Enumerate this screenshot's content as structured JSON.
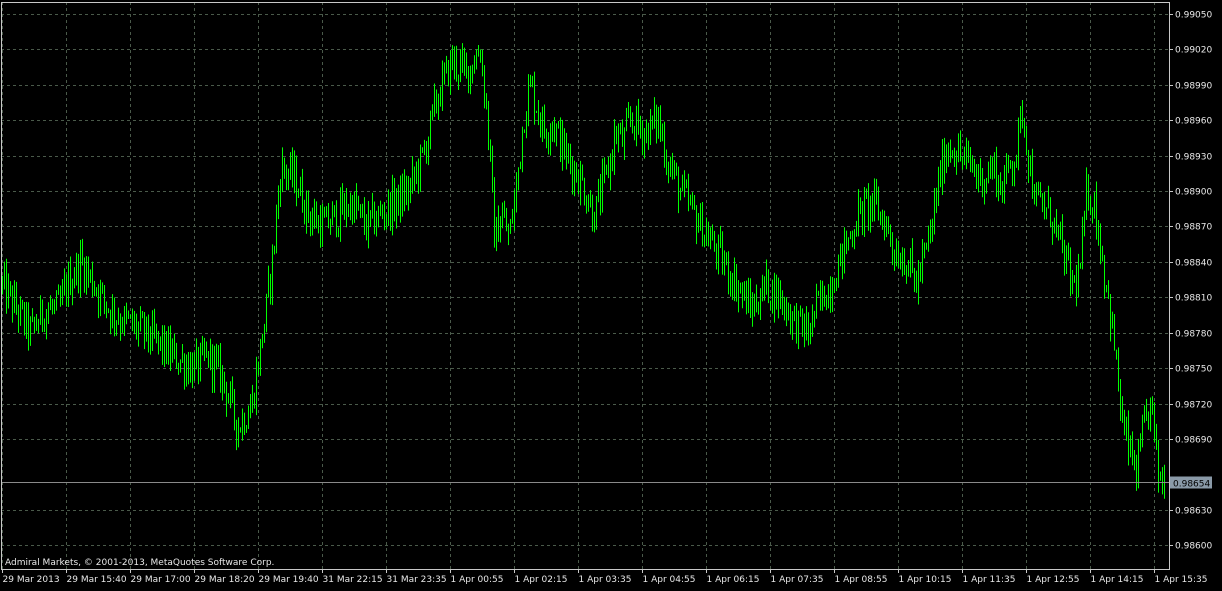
{
  "copyright": "Admiral Markets, © 2001-2013, MetaQuotes Software Corp.",
  "colors": {
    "background": "#000000",
    "grid": "#4a5a4a",
    "frame": "#c8c8c8",
    "bullish": "#00ff00",
    "bearish": "#00ff00",
    "bid_line": "#8a8a8a",
    "bid_label_bg": "#8a9aa8",
    "text": "#e8e8e8"
  },
  "chart_data": {
    "type": "candlestick",
    "grid": true,
    "ylim": [
      0.9858,
      0.9906
    ],
    "y_ticks": [
      "0.99050",
      "0.99020",
      "0.98990",
      "0.98960",
      "0.98930",
      "0.98900",
      "0.98870",
      "0.98840",
      "0.98810",
      "0.98780",
      "0.98750",
      "0.98720",
      "0.98690",
      "0.98630",
      "0.98600"
    ],
    "x_ticks": [
      "29 Mar 2013",
      "29 Mar 15:40",
      "29 Mar 17:00",
      "29 Mar 18:20",
      "29 Mar 19:40",
      "31 Mar 22:15",
      "31 Mar 23:35",
      "1 Apr 00:55",
      "1 Apr 02:15",
      "1 Apr 03:35",
      "1 Apr 04:55",
      "1 Apr 06:15",
      "1 Apr 07:35",
      "1 Apr 08:55",
      "1 Apr 10:15",
      "1 Apr 11:35",
      "1 Apr 12:55",
      "1 Apr 14:15",
      "1 Apr 15:35"
    ],
    "current_bid": "0.98654",
    "close_path": [
      [
        0,
        0.9882
      ],
      [
        2,
        0.988
      ],
      [
        4,
        0.9878
      ],
      [
        6,
        0.988
      ],
      [
        8,
        0.988
      ],
      [
        9,
        0.9882
      ],
      [
        11,
        0.9884
      ],
      [
        13,
        0.9882
      ],
      [
        15,
        0.988
      ],
      [
        17,
        0.9879
      ],
      [
        20,
        0.9878
      ],
      [
        24,
        0.9876
      ],
      [
        27,
        0.9875
      ],
      [
        29,
        0.9876
      ],
      [
        31,
        0.9874
      ],
      [
        33,
        0.987
      ],
      [
        35,
        0.9872
      ],
      [
        36,
        0.9876
      ],
      [
        37,
        0.988
      ],
      [
        38,
        0.9885
      ],
      [
        39,
        0.9892
      ],
      [
        41,
        0.9891
      ],
      [
        43,
        0.9888
      ],
      [
        45,
        0.9887
      ],
      [
        47,
        0.9888
      ],
      [
        49,
        0.9889
      ],
      [
        51,
        0.9887
      ],
      [
        53,
        0.9888
      ],
      [
        55,
        0.9889
      ],
      [
        57,
        0.989
      ],
      [
        59,
        0.9893
      ],
      [
        61,
        0.9898
      ],
      [
        63,
        0.9901
      ],
      [
        65,
        0.99
      ],
      [
        66,
        0.9901
      ],
      [
        67,
        0.9902
      ],
      [
        68,
        0.9896
      ],
      [
        69,
        0.9886
      ],
      [
        70,
        0.9888
      ],
      [
        71,
        0.9886
      ],
      [
        72,
        0.989
      ],
      [
        73,
        0.9896
      ],
      [
        74,
        0.9899
      ],
      [
        75,
        0.9897
      ],
      [
        76,
        0.9895
      ],
      [
        77,
        0.9896
      ],
      [
        79,
        0.9893
      ],
      [
        81,
        0.9891
      ],
      [
        83,
        0.9888
      ],
      [
        85,
        0.9892
      ],
      [
        86,
        0.9895
      ],
      [
        87,
        0.9894
      ],
      [
        88,
        0.9896
      ],
      [
        90,
        0.9895
      ],
      [
        92,
        0.9896
      ],
      [
        93,
        0.9893
      ],
      [
        95,
        0.989
      ],
      [
        97,
        0.9888
      ],
      [
        99,
        0.9886
      ],
      [
        101,
        0.9884
      ],
      [
        103,
        0.9882
      ],
      [
        105,
        0.988
      ],
      [
        107,
        0.9882
      ],
      [
        109,
        0.9881
      ],
      [
        111,
        0.9879
      ],
      [
        113,
        0.9878
      ],
      [
        114,
        0.988
      ],
      [
        116,
        0.9882
      ],
      [
        118,
        0.9885
      ],
      [
        120,
        0.9888
      ],
      [
        122,
        0.9889
      ],
      [
        124,
        0.9887
      ],
      [
        125,
        0.9885
      ],
      [
        127,
        0.9884
      ],
      [
        128,
        0.9882
      ],
      [
        130,
        0.9886
      ],
      [
        131,
        0.989
      ],
      [
        132,
        0.9893
      ],
      [
        133,
        0.9894
      ],
      [
        134,
        0.9893
      ],
      [
        136,
        0.9892
      ],
      [
        137,
        0.9891
      ],
      [
        139,
        0.9892
      ],
      [
        140,
        0.989
      ],
      [
        141,
        0.9892
      ],
      [
        142,
        0.9893
      ],
      [
        143,
        0.9897
      ],
      [
        144,
        0.9892
      ],
      [
        145,
        0.9889
      ],
      [
        147,
        0.9888
      ],
      [
        148,
        0.9886
      ],
      [
        149,
        0.9884
      ],
      [
        150,
        0.9882
      ],
      [
        151,
        0.9883
      ],
      [
        152,
        0.989
      ],
      [
        153,
        0.9889
      ],
      [
        154,
        0.9885
      ],
      [
        155,
        0.9881
      ],
      [
        156,
        0.9876
      ],
      [
        157,
        0.987
      ],
      [
        158,
        0.9868
      ],
      [
        159,
        0.9866
      ],
      [
        160,
        0.987
      ],
      [
        161,
        0.9872
      ],
      [
        162,
        0.9866
      ],
      [
        163,
        0.98655
      ]
    ]
  }
}
